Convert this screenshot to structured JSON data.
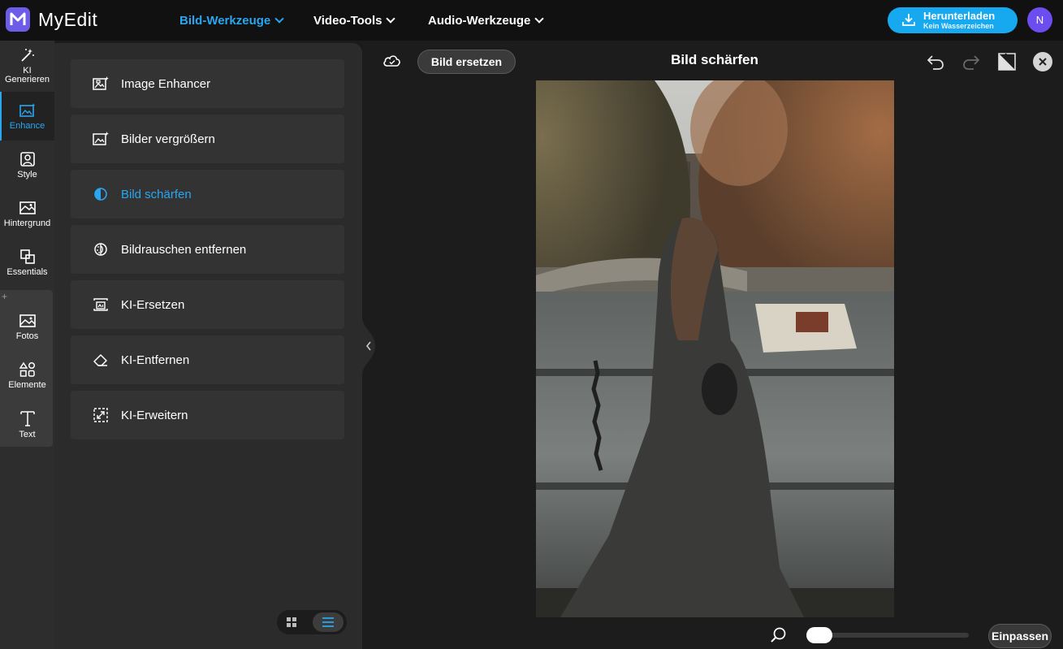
{
  "app": {
    "name": "MyEdit",
    "avatar_initial": "N"
  },
  "nav": [
    {
      "label": "Bild-Werkzeuge",
      "active": true
    },
    {
      "label": "Video-Tools",
      "active": false
    },
    {
      "label": "Audio-Werkzeuge",
      "active": false
    }
  ],
  "download": {
    "label": "Herunterladen",
    "sublabel": "Kein Wasserzeichen"
  },
  "sidebar": {
    "items": [
      {
        "label_line1": "KI",
        "label_line2": "Generieren",
        "icon": "magic-wand-icon"
      },
      {
        "label": "Enhance",
        "icon": "enhance-icon",
        "active": true
      },
      {
        "label": "Style",
        "icon": "style-icon"
      },
      {
        "label": "Hintergrund",
        "icon": "background-icon"
      },
      {
        "label": "Essentials",
        "icon": "essentials-icon"
      }
    ],
    "group_plus": "+",
    "group_items": [
      {
        "label": "Fotos",
        "icon": "photo-icon"
      },
      {
        "label": "Elemente",
        "icon": "shapes-icon"
      },
      {
        "label": "Text",
        "icon": "text-icon"
      }
    ]
  },
  "tools": [
    {
      "label": "Image Enhancer",
      "icon": "image-enhancer-icon"
    },
    {
      "label": "Bilder vergrößern",
      "icon": "image-upscale-icon"
    },
    {
      "label": "Bild schärfen",
      "icon": "sharpen-icon",
      "active": true
    },
    {
      "label": "Bildrauschen entfernen",
      "icon": "denoise-icon"
    },
    {
      "label": "KI-Ersetzen",
      "icon": "ai-replace-icon"
    },
    {
      "label": "KI-Entfernen",
      "icon": "eraser-icon"
    },
    {
      "label": "KI-Erweitern",
      "icon": "expand-icon"
    }
  ],
  "canvas": {
    "replace_label": "Bild ersetzen",
    "title": "Bild schärfen",
    "fit_label": "Einpassen"
  },
  "colors": {
    "accent": "#2aa6f0",
    "download": "#16a9f0",
    "logo": "#6c5ce7",
    "avatar": "#6c4ef0"
  }
}
